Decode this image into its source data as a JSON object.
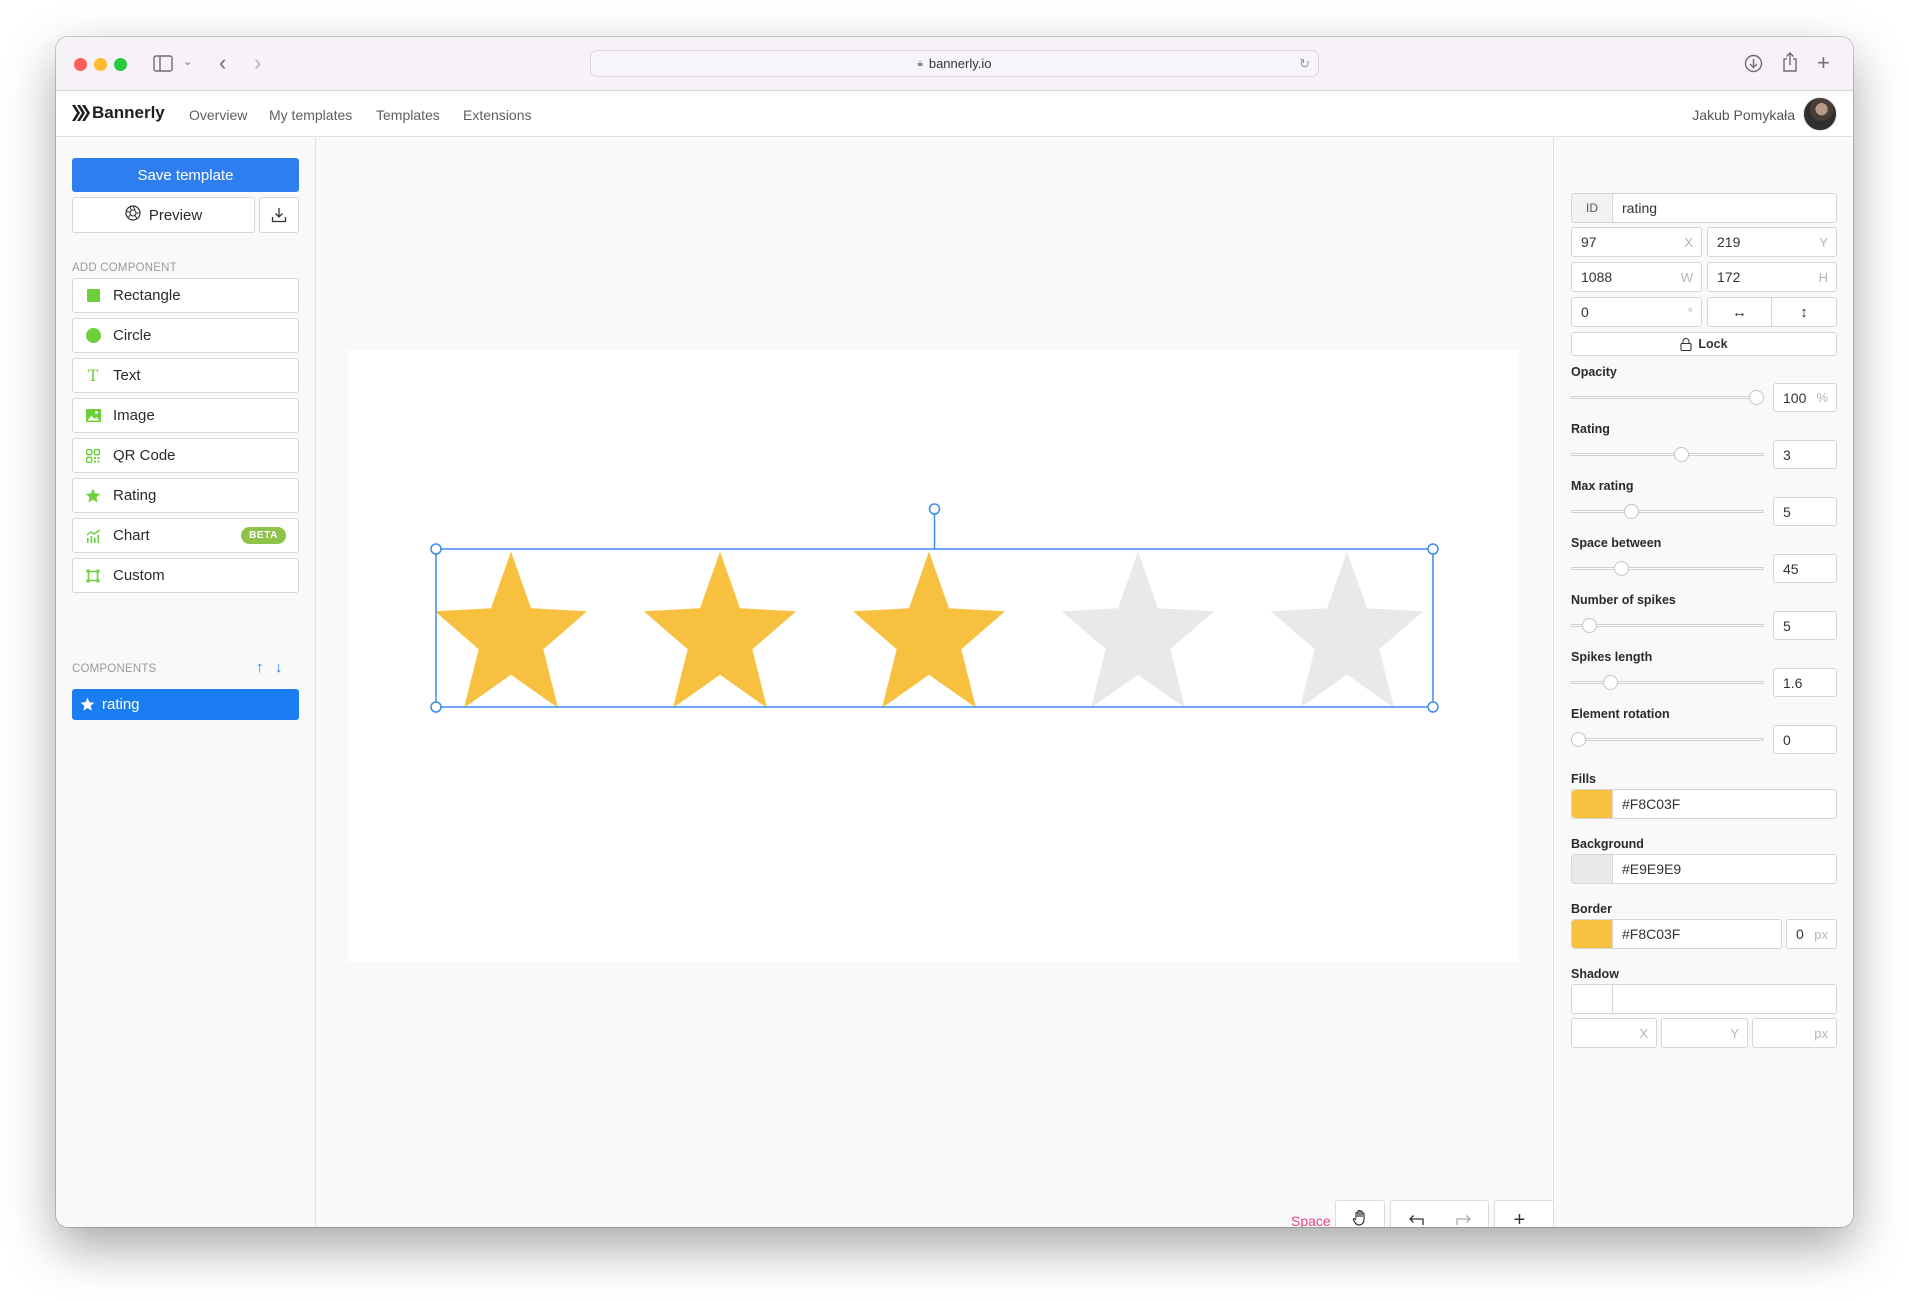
{
  "browser": {
    "url": "bannerly.io",
    "traffic_lights": {
      "close": "#ff5f57",
      "minimize": "#febc2e",
      "maximize": "#28c840"
    }
  },
  "app": {
    "logo": "Bannerly",
    "nav": [
      "Overview",
      "My templates",
      "Templates",
      "Extensions"
    ],
    "user": "Jakub Pomykała"
  },
  "sidebar": {
    "save_label": "Save template",
    "preview_label": "Preview",
    "add_component_label": "ADD COMPONENT",
    "components": [
      {
        "label": "Rectangle",
        "icon": "square-icon"
      },
      {
        "label": "Circle",
        "icon": "circle-icon"
      },
      {
        "label": "Text",
        "icon": "text-icon"
      },
      {
        "label": "Image",
        "icon": "image-icon"
      },
      {
        "label": "QR Code",
        "icon": "qr-code-icon"
      },
      {
        "label": "Rating",
        "icon": "star-icon"
      },
      {
        "label": "Chart",
        "icon": "chart-icon",
        "badge": "BETA"
      },
      {
        "label": "Custom",
        "icon": "custom-shape-icon"
      }
    ],
    "layers_label": "COMPONENTS",
    "layers": [
      {
        "label": "rating",
        "selected": true
      }
    ]
  },
  "canvas": {
    "rating_value": 3,
    "max_rating": 5,
    "fill_color": "#F8C03F",
    "background_color": "#E9E9E9",
    "selection_color": "#3b8bf0"
  },
  "bottom_toolbar": {
    "hint": "Space",
    "hint_color": "#e0458a"
  },
  "properties": {
    "id_label": "ID",
    "id_value": "rating",
    "x": "97",
    "x_suffix": "X",
    "y": "219",
    "y_suffix": "Y",
    "w": "1088",
    "w_suffix": "W",
    "h": "172",
    "h_suffix": "H",
    "rotation": "0",
    "rotation_suffix": "°",
    "lock_label": "Lock",
    "opacity_label": "Opacity",
    "opacity": "100",
    "opacity_suffix": "%",
    "opacity_fraction": 1.0,
    "rating_label": "Rating",
    "rating": "3",
    "rating_fraction": 0.58,
    "max_rating_label": "Max rating",
    "max_rating": "5",
    "max_rating_fraction": 0.3,
    "space_label": "Space between",
    "space": "45",
    "space_fraction": 0.24,
    "spikes_label": "Number of spikes",
    "spikes": "5",
    "spikes_fraction": 0.06,
    "spikes_length_label": "Spikes length",
    "spikes_length": "1.6",
    "spikes_length_fraction": 0.18,
    "element_rotation_label": "Element rotation",
    "element_rotation": "0",
    "element_rotation_fraction": 0.0,
    "fills_label": "Fills",
    "fills": "#F8C03F",
    "background_label": "Background",
    "background": "#E9E9E9",
    "border_label": "Border",
    "border": "#F8C03F",
    "border_width": "0",
    "border_unit": "px",
    "shadow_label": "Shadow",
    "shadow_color": "",
    "shadow_x_suffix": "X",
    "shadow_y_suffix": "Y",
    "shadow_blur_suffix": "px"
  }
}
